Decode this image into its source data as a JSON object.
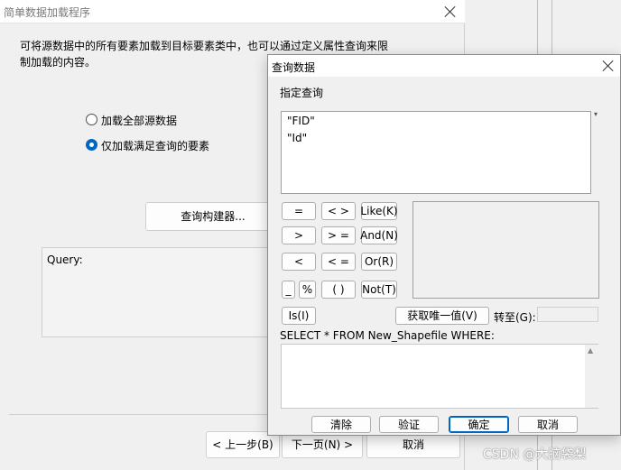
{
  "wizard": {
    "title": "简单数据加载程序",
    "description_line1": "可将源数据中的所有要素加载到目标要素类中，也可以通过定义属性查询来限",
    "description_line2": "制加载的内容。",
    "radio_all": "加载全部源数据",
    "radio_query": "仅加载满足查询的要素",
    "query_builder_button": "查询构建器...",
    "query_label": "Query:",
    "back_button": "< 上一步(B)",
    "next_button": "下一页(N) >",
    "cancel_button": "取消"
  },
  "dialog": {
    "title": "查询数据",
    "section_label": "指定查询",
    "fields": [
      "\"FID\"",
      "\"Id\""
    ],
    "operators": {
      "eq": "=",
      "ne": "< >",
      "like": "Like(K)",
      "gt": ">",
      "ge": "> =",
      "and": "And(N)",
      "lt": "<",
      "le": "< =",
      "or": "Or(R)",
      "underscore": "_",
      "percent": "%",
      "parens": "( )",
      "not": "Not(T)",
      "is": "Is(I)"
    },
    "get_unique_button": "获取唯一值(V)",
    "goto_label": "转至(G):",
    "sql_prefix": "SELECT * FROM New_Shapefile WHERE:",
    "sql_text": "",
    "clear_button": "清除",
    "verify_button": "验证",
    "ok_button": "确定",
    "cancel_button": "取消"
  },
  "watermark": "CSDN @大脑袋梨"
}
